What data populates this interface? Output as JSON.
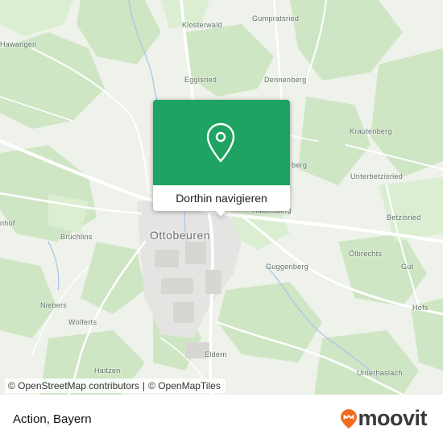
{
  "map": {
    "places": [
      {
        "name": "Hawangen"
      },
      {
        "name": "Klosterwald"
      },
      {
        "name": "Gumpratsried"
      },
      {
        "name": "Eggisried"
      },
      {
        "name": "Dennenberg"
      },
      {
        "name": "Krautenberg"
      },
      {
        "name": "Unterbetzisried"
      },
      {
        "name": "Betzisried"
      },
      {
        "name": "Ölbrechts"
      },
      {
        "name": "Gut"
      },
      {
        "name": "Hofs"
      },
      {
        "name": "Guggenberg"
      },
      {
        "name": "Brüchlins"
      },
      {
        "name": "Niebers"
      },
      {
        "name": "Wolferts"
      },
      {
        "name": "Haitzen"
      },
      {
        "name": "Eldern"
      },
      {
        "name": "Unterhaslach"
      },
      {
        "name": "nhof"
      },
      {
        "name": "berg"
      },
      {
        "name": "Hübelsberg"
      }
    ],
    "town": "Ottobeuren"
  },
  "popup": {
    "action_label": "Dorthin navigieren",
    "color": "#1ea362"
  },
  "attribution": {
    "osm": "© OpenStreetMap contributors",
    "sep": "|",
    "tiles": "© OpenMapTiles"
  },
  "footer": {
    "title": "Action, Bayern",
    "logo_text": "moovit",
    "logo_color": "#f26b21"
  }
}
